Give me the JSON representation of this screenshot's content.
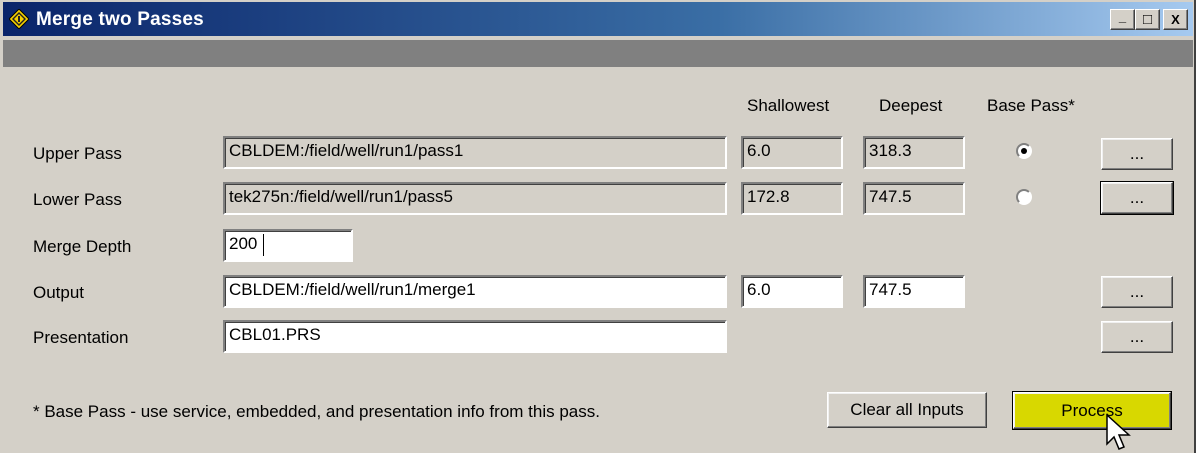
{
  "window": {
    "title": "Merge two Passes",
    "controls": [
      "_",
      "□",
      "X"
    ]
  },
  "columns": {
    "shallowest": "Shallowest",
    "deepest": "Deepest",
    "base_pass": "Base Pass*"
  },
  "rows": {
    "upper": {
      "label": "Upper Pass",
      "path": "CBLDEM:/field/well/run1/pass1",
      "shallowest": "6.0",
      "deepest": "318.3",
      "base_selected": true,
      "browse": "..."
    },
    "lower": {
      "label": "Lower Pass",
      "path": "tek275n:/field/well/run1/pass5",
      "shallowest": "172.8",
      "deepest": "747.5",
      "base_selected": false,
      "browse": "..."
    },
    "merge_depth": {
      "label": "Merge Depth",
      "value": "200"
    },
    "output": {
      "label": "Output",
      "path": "CBLDEM:/field/well/run1/merge1",
      "shallowest": "6.0",
      "deepest": "747.5",
      "browse": "..."
    },
    "presentation": {
      "label": "Presentation",
      "value": "CBL01.PRS",
      "browse": "..."
    }
  },
  "footer": {
    "note": "* Base Pass - use service, embedded, and presentation info from this pass.",
    "clear_label": "Clear all Inputs",
    "process_label": "Process"
  },
  "colors": {
    "title_gradient_start": "#0a246a",
    "title_gradient_end": "#a6caf0",
    "process_button": "#d8d800",
    "face": "#d4d0c8"
  },
  "icons": {
    "app": "yellow-diamond-icon",
    "cursor": "mouse-pointer-icon"
  }
}
